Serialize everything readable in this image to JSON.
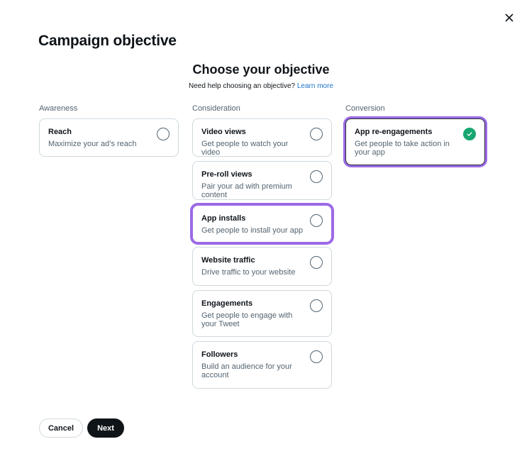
{
  "dialog": {
    "title": "Campaign objective",
    "close_icon": "close-icon"
  },
  "objective": {
    "heading": "Choose your objective",
    "help_text": "Need help choosing an objective?",
    "help_link": "Learn more"
  },
  "columns": {
    "awareness": {
      "label": "Awareness",
      "options": [
        {
          "title": "Reach",
          "desc": "Maximize your ad’s reach",
          "checked": false
        }
      ]
    },
    "consideration": {
      "label": "Consideration",
      "options": [
        {
          "title": "Video views",
          "desc": "Get people to watch your video",
          "checked": false
        },
        {
          "title": "Pre-roll views",
          "desc": "Pair your ad with premium content",
          "checked": false
        },
        {
          "title": "App installs",
          "desc": "Get people to install your app",
          "checked": false,
          "focused": true
        },
        {
          "title": "Website traffic",
          "desc": "Drive traffic to your website",
          "checked": false
        },
        {
          "title": "Engagements",
          "desc": "Get people to engage with your Tweet",
          "checked": false
        },
        {
          "title": "Followers",
          "desc": "Build an audience for your account",
          "checked": false
        }
      ]
    },
    "conversion": {
      "label": "Conversion",
      "options": [
        {
          "title": "App re-engagements",
          "desc": "Get people to take action in your app",
          "checked": true
        }
      ]
    }
  },
  "footer": {
    "cancel_label": "Cancel",
    "next_label": "Next"
  },
  "colors": {
    "accent_focus": "#9b6ae6",
    "check_green": "#17a672",
    "link_blue": "#1d73c9",
    "primary_button": "#0f1419"
  }
}
